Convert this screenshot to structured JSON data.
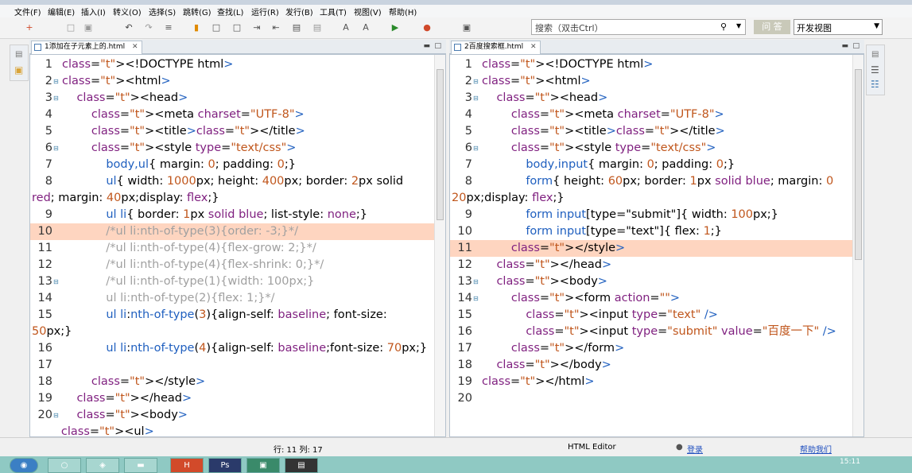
{
  "menu": [
    "文件(F)",
    "编辑(E)",
    "插入(I)",
    "转义(O)",
    "选择(S)",
    "跳转(G)",
    "查找(L)",
    "运行(R)",
    "发行(B)",
    "工具(T)",
    "视图(V)",
    "帮助(H)"
  ],
  "search": {
    "placeholder": "搜索（双击Ctrl）"
  },
  "ask_label": "问 答",
  "view_select": "开发视图",
  "left_tab": "1添加在子元素上的.html",
  "right_tab": "2百度搜索框.html",
  "left_lines": [
    {
      "n": "1",
      "code": "<!DOCTYPE html>",
      "fold": false
    },
    {
      "n": "2",
      "code": "<html>",
      "fold": true
    },
    {
      "n": "3",
      "code": "    <head>",
      "fold": true
    },
    {
      "n": "4",
      "code": "        <meta charset=\"UTF-8\">",
      "fold": false
    },
    {
      "n": "5",
      "code": "        <title></title>",
      "fold": false
    },
    {
      "n": "6",
      "code": "        <style type=\"text/css\">",
      "fold": true
    },
    {
      "n": "7",
      "code": "            body,ul{ margin: 0; padding: 0;}",
      "fold": false
    },
    {
      "n": "8",
      "code": "            ul{ width: 1000px; height: 400px; border: 2px solid",
      "fold": false
    },
    {
      "n": "",
      "code": "red; margin: 40px;display: flex;}",
      "fold": false
    },
    {
      "n": "9",
      "code": "            ul li{ border: 1px solid blue; list-style: none;}",
      "fold": false
    },
    {
      "n": "10",
      "code": "            /*ul li:nth-of-type(3){order: -3;}*/",
      "fold": false,
      "hl": true
    },
    {
      "n": "11",
      "code": "            /*ul li:nth-of-type(4){flex-grow: 2;}*/",
      "fold": false
    },
    {
      "n": "12",
      "code": "            /*ul li:nth-of-type(4){flex-shrink: 0;}*/",
      "fold": false
    },
    {
      "n": "13",
      "code": "            /*ul li:nth-of-type(1){width: 100px;}",
      "fold": true
    },
    {
      "n": "14",
      "code": "            ul li:nth-of-type(2){flex: 1;}*/",
      "fold": false
    },
    {
      "n": "15",
      "code": "            ul li:nth-of-type(3){align-self: baseline; font-size:",
      "fold": false
    },
    {
      "n": "",
      "code": "50px;}",
      "fold": false
    },
    {
      "n": "16",
      "code": "            ul li:nth-of-type(4){align-self: baseline;font-size: 70px;}",
      "fold": false
    },
    {
      "n": "17",
      "code": "",
      "fold": false
    },
    {
      "n": "18",
      "code": "        </style>",
      "fold": false
    },
    {
      "n": "19",
      "code": "    </head>",
      "fold": false
    },
    {
      "n": "20",
      "code": "    <body>",
      "fold": true
    },
    {
      "n": "",
      "code": "        <ul>",
      "fold": false
    }
  ],
  "right_lines": [
    {
      "n": "1",
      "code": "<!DOCTYPE html>",
      "fold": false
    },
    {
      "n": "2",
      "code": "<html>",
      "fold": true
    },
    {
      "n": "3",
      "code": "    <head>",
      "fold": true
    },
    {
      "n": "4",
      "code": "        <meta charset=\"UTF-8\">",
      "fold": false
    },
    {
      "n": "5",
      "code": "        <title></title>",
      "fold": false
    },
    {
      "n": "6",
      "code": "        <style type=\"text/css\">",
      "fold": true
    },
    {
      "n": "7",
      "code": "            body,input{ margin: 0; padding: 0;}",
      "fold": false
    },
    {
      "n": "8",
      "code": "            form{ height: 60px; border: 1px solid blue; margin: 0",
      "fold": false
    },
    {
      "n": "",
      "code": "20px;display: flex;}",
      "fold": false
    },
    {
      "n": "9",
      "code": "            form input[type=\"submit\"]{ width: 100px;}",
      "fold": false
    },
    {
      "n": "10",
      "code": "            form input[type=\"text\"]{ flex: 1;}",
      "fold": false
    },
    {
      "n": "11",
      "code": "        </style>",
      "fold": false,
      "hl": true
    },
    {
      "n": "12",
      "code": "    </head>",
      "fold": false
    },
    {
      "n": "13",
      "code": "    <body>",
      "fold": true
    },
    {
      "n": "14",
      "code": "        <form action=\"\">",
      "fold": true
    },
    {
      "n": "15",
      "code": "            <input type=\"text\" />",
      "fold": false
    },
    {
      "n": "16",
      "code": "            <input type=\"submit\" value=\"百度一下\" />",
      "fold": false
    },
    {
      "n": "17",
      "code": "        </form>",
      "fold": false
    },
    {
      "n": "18",
      "code": "    </body>",
      "fold": false
    },
    {
      "n": "19",
      "code": "</html>",
      "fold": false
    },
    {
      "n": "20",
      "code": "",
      "fold": false
    }
  ],
  "status": {
    "position": "行: 11 列: 17",
    "editor": "HTML Editor",
    "login": "登录",
    "help": "帮助我们"
  },
  "clock": "15:11",
  "colors": {
    "highlight": "#fed5c0",
    "tag": "#1f5fbf",
    "attr": "#7f1f7f",
    "value": "#c0561c",
    "comment": "#a0a0a0"
  }
}
